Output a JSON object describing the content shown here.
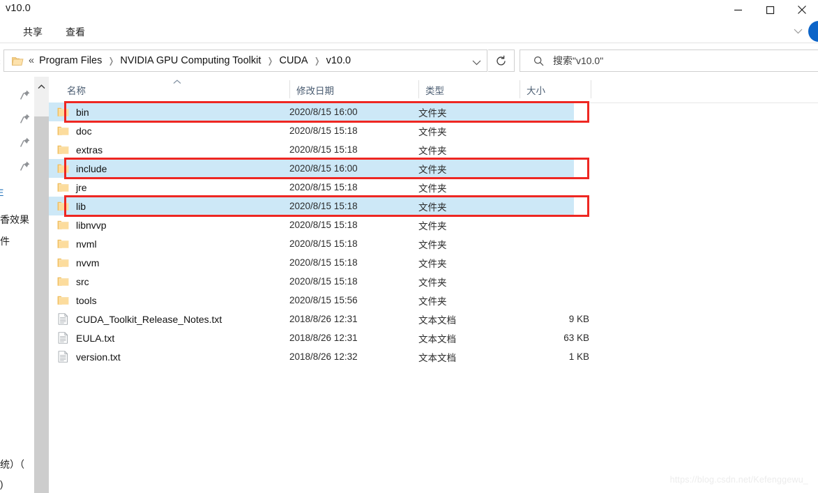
{
  "window": {
    "title": "v10.0",
    "minimize_label": "minimize",
    "maximize_label": "maximize",
    "close_label": "close"
  },
  "ribbon": {
    "tabs": [
      {
        "label": "共享"
      },
      {
        "label": "查看"
      }
    ],
    "expand_caret": "chevron-down",
    "help_badge": "help"
  },
  "address": {
    "root_icon": "folder-icon",
    "overflow": "«",
    "separator": "›",
    "crumbs": [
      "Program Files",
      "NVIDIA GPU Computing Toolkit",
      "CUDA",
      "v10.0"
    ],
    "dropdown_caret": "chevron-down",
    "refresh_icon": "refresh-icon"
  },
  "search": {
    "icon": "search-icon",
    "value": "搜索\"v10.0\"",
    "placeholder": "搜索\"v10.0\""
  },
  "nav_pane": {
    "pin_icon": "pin-icon",
    "pin_count": 4,
    "fragments": [
      {
        "text": "E",
        "color_class": "blue"
      },
      {
        "text": "加香效果"
      },
      {
        "text": "文件"
      },
      {
        "text": "系统）（"
      },
      {
        "text": ":)"
      }
    ]
  },
  "scrollbar": {
    "up_arrow": "chevron-up-icon",
    "orientation": "vertical"
  },
  "list": {
    "columns": [
      {
        "key": "name",
        "label": "名称",
        "sorted": "asc"
      },
      {
        "key": "date",
        "label": "修改日期"
      },
      {
        "key": "type",
        "label": "类型"
      },
      {
        "key": "size",
        "label": "大小"
      }
    ],
    "rows": [
      {
        "name": "bin",
        "date": "2020/8/15 16:00",
        "type": "文件夹",
        "size": "",
        "icon": "folder-icon",
        "selected": true,
        "annotated": true
      },
      {
        "name": "doc",
        "date": "2020/8/15 15:18",
        "type": "文件夹",
        "size": "",
        "icon": "folder-icon",
        "selected": false,
        "annotated": false
      },
      {
        "name": "extras",
        "date": "2020/8/15 15:18",
        "type": "文件夹",
        "size": "",
        "icon": "folder-icon",
        "selected": false,
        "annotated": false
      },
      {
        "name": "include",
        "date": "2020/8/15 16:00",
        "type": "文件夹",
        "size": "",
        "icon": "folder-icon",
        "selected": true,
        "annotated": true
      },
      {
        "name": "jre",
        "date": "2020/8/15 15:18",
        "type": "文件夹",
        "size": "",
        "icon": "folder-icon",
        "selected": false,
        "annotated": false
      },
      {
        "name": "lib",
        "date": "2020/8/15 15:18",
        "type": "文件夹",
        "size": "",
        "icon": "folder-icon",
        "selected": true,
        "annotated": true
      },
      {
        "name": "libnvvp",
        "date": "2020/8/15 15:18",
        "type": "文件夹",
        "size": "",
        "icon": "folder-icon",
        "selected": false,
        "annotated": false
      },
      {
        "name": "nvml",
        "date": "2020/8/15 15:18",
        "type": "文件夹",
        "size": "",
        "icon": "folder-icon",
        "selected": false,
        "annotated": false
      },
      {
        "name": "nvvm",
        "date": "2020/8/15 15:18",
        "type": "文件夹",
        "size": "",
        "icon": "folder-icon",
        "selected": false,
        "annotated": false
      },
      {
        "name": "src",
        "date": "2020/8/15 15:18",
        "type": "文件夹",
        "size": "",
        "icon": "folder-icon",
        "selected": false,
        "annotated": false
      },
      {
        "name": "tools",
        "date": "2020/8/15 15:56",
        "type": "文件夹",
        "size": "",
        "icon": "folder-icon",
        "selected": false,
        "annotated": false
      },
      {
        "name": "CUDA_Toolkit_Release_Notes.txt",
        "date": "2018/8/26 12:31",
        "type": "文本文档",
        "size": "9 KB",
        "icon": "text-file-icon",
        "selected": false,
        "annotated": false
      },
      {
        "name": "EULA.txt",
        "date": "2018/8/26 12:31",
        "type": "文本文档",
        "size": "63 KB",
        "icon": "text-file-icon",
        "selected": false,
        "annotated": false
      },
      {
        "name": "version.txt",
        "date": "2018/8/26 12:32",
        "type": "文本文档",
        "size": "1 KB",
        "icon": "text-file-icon",
        "selected": false,
        "annotated": false
      }
    ]
  },
  "annotation": {
    "color": "#ee2722"
  },
  "watermark": {
    "text": "https://blog.csdn.net/Kefenggewu_"
  }
}
